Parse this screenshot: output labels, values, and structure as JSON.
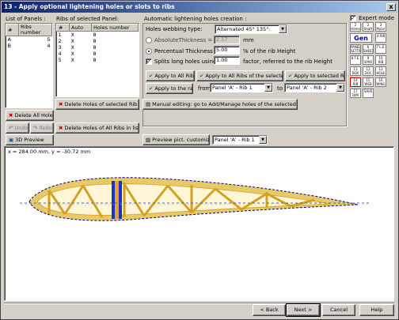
{
  "window": {
    "title": "13 - Apply optional lightening holes or slots to ribs",
    "close_glyph": "x"
  },
  "panels": {
    "label": "List of Panels :",
    "columns": [
      "#",
      "Ribs number"
    ],
    "rows": [
      [
        "A",
        "5"
      ],
      [
        "B",
        "4"
      ]
    ]
  },
  "ribs": {
    "label": "Ribs of selected Panel:",
    "columns": [
      "#",
      "Auto",
      "Holes number"
    ],
    "rows": [
      [
        "1",
        "X",
        "8"
      ],
      [
        "2",
        "X",
        "8"
      ],
      [
        "3",
        "X",
        "8"
      ],
      [
        "4",
        "X",
        "8"
      ],
      [
        "5",
        "X",
        "8"
      ]
    ]
  },
  "buttons": {
    "delete_all_holes": "Delete All Holes!",
    "undo": "Undo",
    "redo": "Redo",
    "delete_holes_selected_rib": "Delete Holes of selected Rib",
    "preview_3d": "3D Preview",
    "delete_holes_all_ribs": "Delete Holes of All Ribs in list",
    "apply_all_ribs": "Apply to All Ribs!",
    "apply_all_ribs_panel": "Apply to All Ribs of the selected Panel",
    "apply_selected_rib": "Apply to selected Rib",
    "apply_range": "Apply to the range:",
    "manual_editing": "Manual editing: go to Add/Manage holes of the selected rib",
    "preview_pict": "Preview pict. customization",
    "back": "< Back",
    "next": "Next >",
    "cancel": "Cancel",
    "help": "Help"
  },
  "auto": {
    "title": "Automatic lightening holes creation :",
    "webbing_label": "Holes webbing type:",
    "webbing_value": "Alternated 45° 135°:",
    "absolute_label": "AbsoluteThickness =",
    "absolute_value": "2.57",
    "absolute_unit": "mm",
    "percentual_label": "Percentual Thickness =",
    "percentual_value": "5.00",
    "percentual_unit": "% of the rib Height",
    "split_label": "Splits long holes using a",
    "split_value": "1.00",
    "split_unit": "factor, referred to the rib Height",
    "range_from_label": "from",
    "range_from_value": "Panel 'A' - Rib 1",
    "range_to_label": "to",
    "range_to_value": "Panel 'A' - Rib 2"
  },
  "expert_mode": {
    "label": "Expert mode",
    "checked": true
  },
  "palette": {
    "tools": [
      "2 Home",
      "2 Shaft",
      "3 Mylar",
      "Gen",
      "4 RIB",
      "PANEL SETTING",
      "6 SHEET",
      "7 L.E.",
      "8 T.E.",
      "9 SPAR",
      "10 RIB SLOTS",
      "11 BOX",
      "12 DOC",
      "13 HOLE",
      "14 RIB HOLES",
      "15 WEB",
      "16 WING TIP",
      "17 DIM",
      "SAVE"
    ],
    "gen_label": "Gen"
  },
  "preview": {
    "rib_select": "Panel 'A' - Rib 1",
    "coords": "x = 284.00 mm, y = -30.72 mm"
  },
  "colors": {
    "rib_fill": "#e8c968",
    "rib_stroke": "#d4a020",
    "outline": "#000080",
    "spar": "#2030c0",
    "centerline": "#4060e0"
  }
}
